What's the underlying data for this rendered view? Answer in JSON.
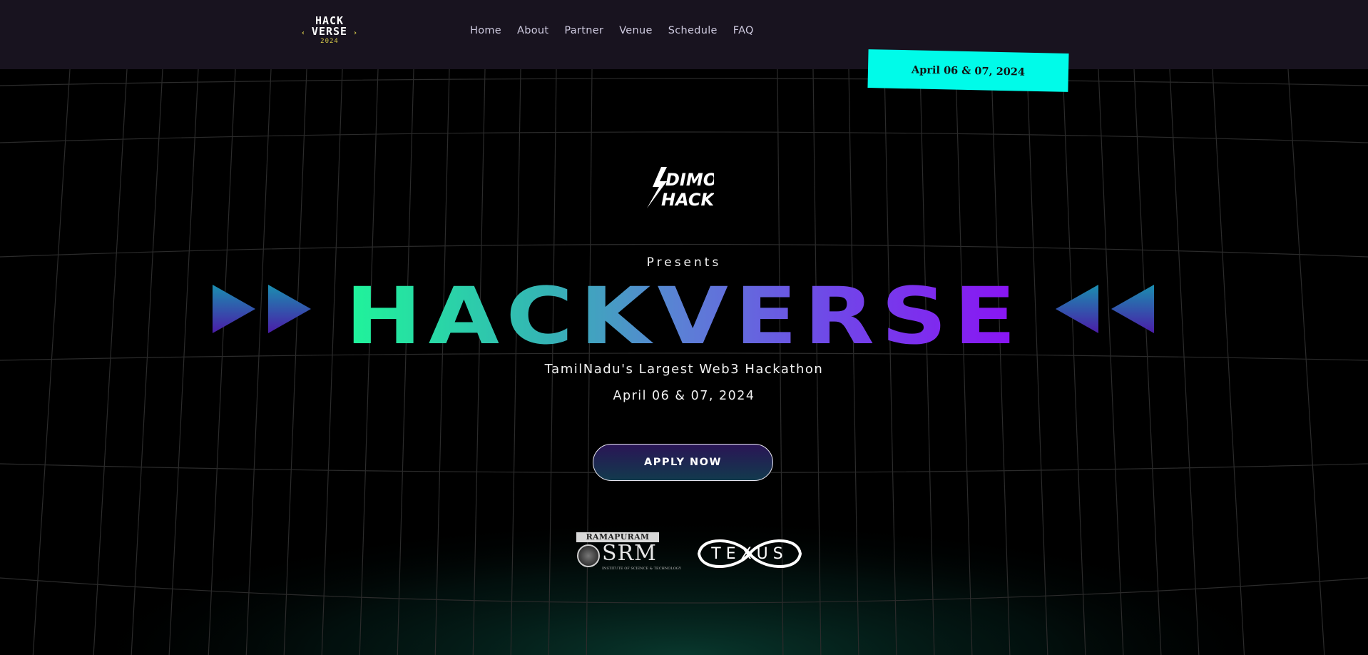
{
  "header": {
    "logo": {
      "line1": "HACK",
      "line2": "VERSE",
      "year": "2024"
    },
    "nav": [
      "Home",
      "About",
      "Partner",
      "Venue",
      "Schedule",
      "FAQ"
    ],
    "date_tag": "April 06 & 07, 2024"
  },
  "hero": {
    "sponsor_logo": {
      "line1": "DIMO",
      "line2": "HACK"
    },
    "presents": "Presents",
    "title": "HACKVERSE",
    "tagline": "TamilNadu's Largest Web3 Hackathon",
    "date": "April 06 & 07, 2024",
    "apply_label": "APPLY NOW"
  },
  "partners": {
    "srm": {
      "top_label": "RAMAPURAM",
      "name": "SRM",
      "subtitle": "INSTITUTE OF SCIENCE & TECHNOLOGY"
    },
    "texus": {
      "name": "TEXUS"
    }
  },
  "colors": {
    "header_bg": "#18131f",
    "date_tag_bg": "#00fbe9",
    "title_gradient_start": "#1ff59a",
    "title_gradient_mid": "#5c7fd6",
    "title_gradient_end": "#8b12f4",
    "logo_accent": "#d6c94a"
  }
}
